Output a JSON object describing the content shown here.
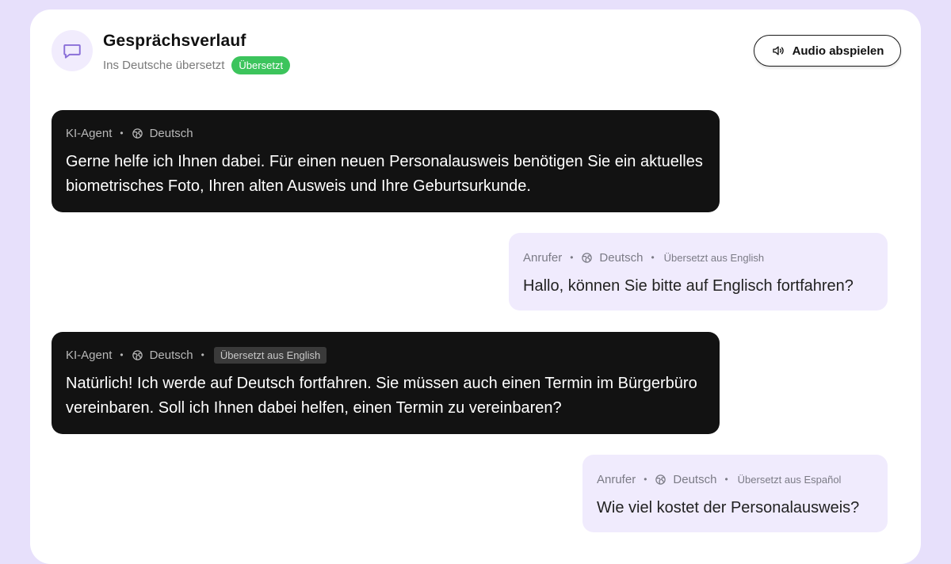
{
  "header": {
    "title": "Gesprächsverlauf",
    "subtitle": "Ins Deutsche übersetzt",
    "badge": "Übersetzt",
    "audio_button_label": "Audio abspielen"
  },
  "colors": {
    "background": "#e7e0fb",
    "agent_bubble": "#121212",
    "caller_bubble": "#f0ebfd",
    "badge_green": "#3cc45c",
    "accent_purple": "#8a6fd8"
  },
  "icons": {
    "header": "chat-bubble-icon",
    "audio": "speaker-icon",
    "language": "globe-icon"
  },
  "messages": [
    {
      "speaker": "KI-Agent",
      "language": "Deutsch",
      "translated_tag": "",
      "text": "Gerne helfe ich Ihnen dabei. Für einen neuen Personalausweis benötigen Sie ein aktuelles biometrisches Foto, Ihren alten Ausweis und Ihre Geburtsurkunde."
    },
    {
      "speaker": "Anrufer",
      "language": "Deutsch",
      "translated_tag": "Übersetzt aus English",
      "text": "Hallo, können Sie bitte auf Englisch fortfahren?"
    },
    {
      "speaker": "KI-Agent",
      "language": "Deutsch",
      "translated_tag": "Übersetzt aus English",
      "text": "Natürlich! Ich werde auf Deutsch fortfahren. Sie müssen auch einen Termin im Bürgerbüro vereinbaren. Soll ich Ihnen dabei helfen, einen Termin zu vereinbaren?"
    },
    {
      "speaker": "Anrufer",
      "language": "Deutsch",
      "translated_tag": "Übersetzt aus Español",
      "text": "Wie viel kostet der Personalausweis?"
    }
  ]
}
